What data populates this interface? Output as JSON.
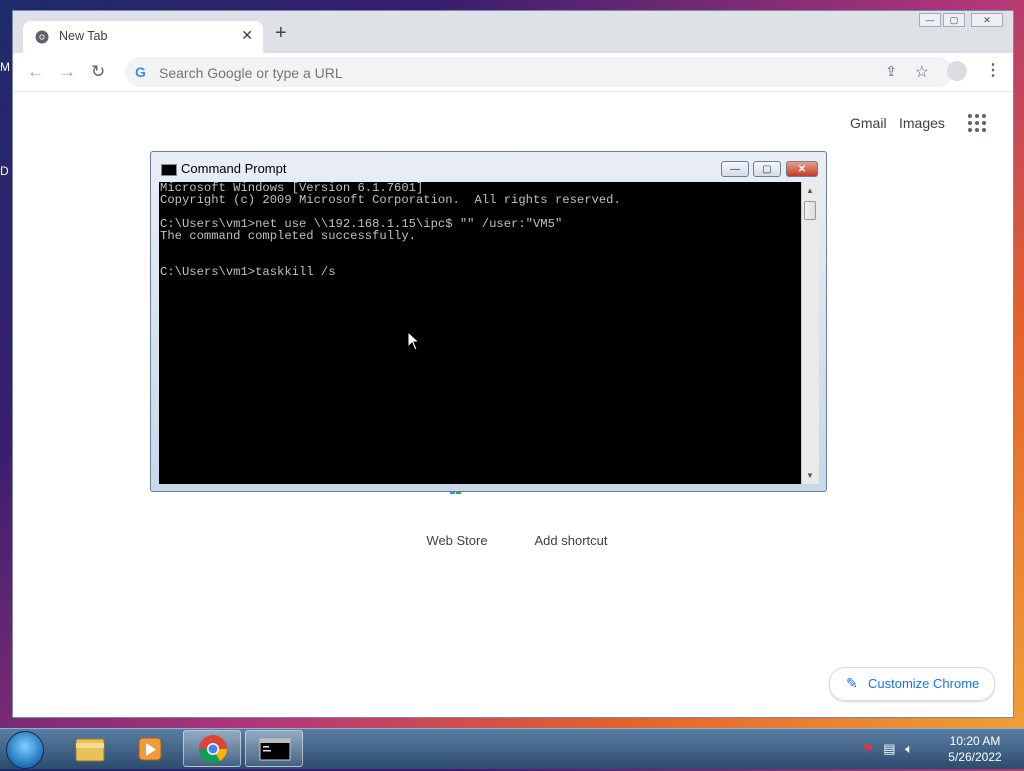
{
  "desktop": {
    "edge_letters": [
      "M",
      "D"
    ]
  },
  "chrome": {
    "tab_title": "New Tab",
    "tab_close": "✕",
    "new_tab": "+",
    "window_controls": {
      "minimize": "—",
      "maximize": "▢",
      "close": "✕"
    },
    "nav": {
      "back": "←",
      "forward": "→",
      "reload": "↻"
    },
    "omnibox_placeholder": "Search Google or type a URL",
    "omnibox_g": "G",
    "links": {
      "gmail": "Gmail",
      "images": "Images"
    },
    "shortcuts": [
      {
        "label": "Web Store"
      },
      {
        "label": "Add shortcut"
      }
    ],
    "customize_label": "Customize Chrome",
    "menu": "⋮"
  },
  "cmd": {
    "title": "Command Prompt",
    "lines": "Microsoft Windows [Version 6.1.7601]\nCopyright (c) 2009 Microsoft Corporation.  All rights reserved.\n\nC:\\Users\\vm1>net use \\\\192.168.1.15\\ipc$ \"\" /user:\"VM5\"\nThe command completed successfully.\n\n\nC:\\Users\\vm1>taskkill /s",
    "controls": {
      "minimize": "—",
      "maximize": "▢",
      "close": "✕"
    }
  },
  "taskbar": {
    "apps": [
      "explorer-icon",
      "media-player-icon",
      "chrome-icon",
      "cmd-icon"
    ],
    "clock_time": "10:20 AM",
    "clock_date": "5/26/2022",
    "colors": {
      "taskbar": "#2c4c6e",
      "accent": "#1a73e8"
    }
  }
}
